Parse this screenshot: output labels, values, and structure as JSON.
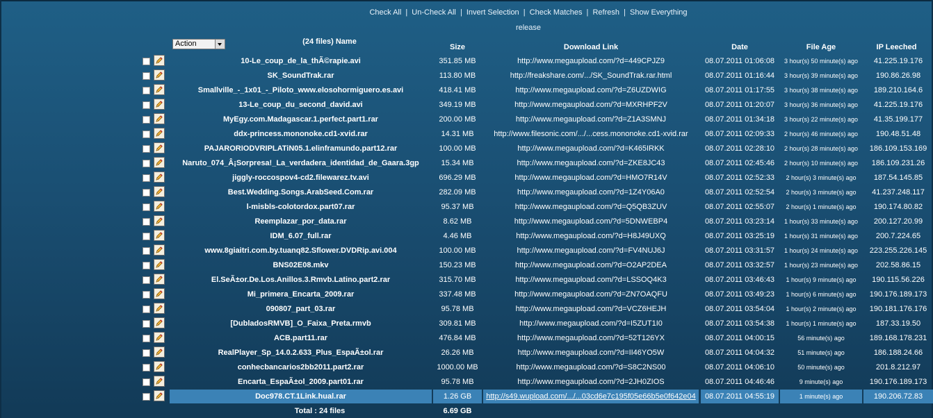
{
  "toolbar": {
    "check_all": "Check All",
    "uncheck_all": "Un-Check All",
    "invert_selection": "Invert Selection",
    "check_matches": "Check Matches",
    "refresh": "Refresh",
    "show_everything": "Show Everything",
    "separator": "|"
  },
  "release_label": "release",
  "action_select": {
    "value": "Action"
  },
  "headers": {
    "name": "(24 files) Name",
    "size": "Size",
    "link": "Download Link",
    "date": "Date",
    "age": "File Age",
    "ip": "IP Leeched"
  },
  "rows": [
    {
      "name": "10-Le_coup_de_la_thÃ©rapie.avi",
      "size": "351.85 MB",
      "link": "http://www.megaupload.com/?d=449CPJZ9",
      "date": "08.07.2011 01:06:08",
      "age": "3 hour(s) 50 minute(s) ago",
      "ip": "41.225.19.176"
    },
    {
      "name": "SK_SoundTrak.rar",
      "size": "113.80 MB",
      "link": "http://freakshare.com/.../SK_SoundTrak.rar.html",
      "date": "08.07.2011 01:16:44",
      "age": "3 hour(s) 39 minute(s) ago",
      "ip": "190.86.26.98"
    },
    {
      "name": "Smallville_-_1x01_-_Piloto_www.elosohormiguero.es.avi",
      "size": "418.41 MB",
      "link": "http://www.megaupload.com/?d=Z6UZDWIG",
      "date": "08.07.2011 01:17:55",
      "age": "3 hour(s) 38 minute(s) ago",
      "ip": "189.210.164.6"
    },
    {
      "name": "13-Le_coup_du_second_david.avi",
      "size": "349.19 MB",
      "link": "http://www.megaupload.com/?d=MXRHPF2V",
      "date": "08.07.2011 01:20:07",
      "age": "3 hour(s) 36 minute(s) ago",
      "ip": "41.225.19.176"
    },
    {
      "name": "MyEgy.com.Madagascar.1.perfect.part1.rar",
      "size": "200.00 MB",
      "link": "http://www.megaupload.com/?d=Z1A3SMNJ",
      "date": "08.07.2011 01:34:18",
      "age": "3 hour(s) 22 minute(s) ago",
      "ip": "41.35.199.177"
    },
    {
      "name": "ddx-princess.mononoke.cd1-xvid.rar",
      "size": "14.31 MB",
      "link": "http://www.filesonic.com/.../...cess.mononoke.cd1-xvid.rar",
      "date": "08.07.2011 02:09:33",
      "age": "2 hour(s) 46 minute(s) ago",
      "ip": "190.48.51.48"
    },
    {
      "name": "PAJARORIODVRIPLATiN05.1.elinframundo.part12.rar",
      "size": "100.00 MB",
      "link": "http://www.megaupload.com/?d=K465IRKK",
      "date": "08.07.2011 02:28:10",
      "age": "2 hour(s) 28 minute(s) ago",
      "ip": "186.109.153.169"
    },
    {
      "name": "Naruto_074_Â¡Sorpresa!_La_verdadera_identidad_de_Gaara.3gp",
      "size": "15.34 MB",
      "link": "http://www.megaupload.com/?d=ZKE8JC43",
      "date": "08.07.2011 02:45:46",
      "age": "2 hour(s) 10 minute(s) ago",
      "ip": "186.109.231.26"
    },
    {
      "name": "jiggly-roccospov4-cd2.filewarez.tv.avi",
      "size": "696.29 MB",
      "link": "http://www.megaupload.com/?d=HMO7R14V",
      "date": "08.07.2011 02:52:33",
      "age": "2 hour(s) 3 minute(s) ago",
      "ip": "187.54.145.85"
    },
    {
      "name": "Best.Wedding.Songs.ArabSeed.Com.rar",
      "size": "282.09 MB",
      "link": "http://www.megaupload.com/?d=1Z4Y06A0",
      "date": "08.07.2011 02:52:54",
      "age": "2 hour(s) 3 minute(s) ago",
      "ip": "41.237.248.117"
    },
    {
      "name": "l-misbls-colotordox.part07.rar",
      "size": "95.37 MB",
      "link": "http://www.megaupload.com/?d=Q5QB3ZUV",
      "date": "08.07.2011 02:55:07",
      "age": "2 hour(s) 1 minute(s) ago",
      "ip": "190.174.80.82"
    },
    {
      "name": "Reemplazar_por_data.rar",
      "size": "8.62 MB",
      "link": "http://www.megaupload.com/?d=5DNWEBP4",
      "date": "08.07.2011 03:23:14",
      "age": "1 hour(s) 33 minute(s) ago",
      "ip": "200.127.20.99"
    },
    {
      "name": "IDM_6.07_full.rar",
      "size": "4.46 MB",
      "link": "http://www.megaupload.com/?d=H8J49UXQ",
      "date": "08.07.2011 03:25:19",
      "age": "1 hour(s) 31 minute(s) ago",
      "ip": "200.7.224.65"
    },
    {
      "name": "www.8giaitri.com.by.tuanq82.Sflower.DVDRip.avi.004",
      "size": "100.00 MB",
      "link": "http://www.megaupload.com/?d=FV4NUJ6J",
      "date": "08.07.2011 03:31:57",
      "age": "1 hour(s) 24 minute(s) ago",
      "ip": "223.255.226.145"
    },
    {
      "name": "BNS02E08.mkv",
      "size": "150.23 MB",
      "link": "http://www.megaupload.com/?d=O2AP2DEA",
      "date": "08.07.2011 03:32:57",
      "age": "1 hour(s) 23 minute(s) ago",
      "ip": "202.58.86.15"
    },
    {
      "name": "El.SeÃ±or.De.Los.Anillos.3.Rmvb.Latino.part2.rar",
      "size": "315.70 MB",
      "link": "http://www.megaupload.com/?d=LSSOQ4K3",
      "date": "08.07.2011 03:46:43",
      "age": "1 hour(s) 9 minute(s) ago",
      "ip": "190.115.56.226"
    },
    {
      "name": "Mi_primera_Encarta_2009.rar",
      "size": "337.48 MB",
      "link": "http://www.megaupload.com/?d=ZN7OAQFU",
      "date": "08.07.2011 03:49:23",
      "age": "1 hour(s) 6 minute(s) ago",
      "ip": "190.176.189.173"
    },
    {
      "name": "090807_part_03.rar",
      "size": "95.78 MB",
      "link": "http://www.megaupload.com/?d=VCZ6HEJH",
      "date": "08.07.2011 03:54:04",
      "age": "1 hour(s) 2 minute(s) ago",
      "ip": "190.181.176.176"
    },
    {
      "name": "[DubladosRMVB]_O_Faixa_Preta.rmvb",
      "size": "309.81 MB",
      "link": "http://www.megaupload.com/?d=I5ZUT1I0",
      "date": "08.07.2011 03:54:38",
      "age": "1 hour(s) 1 minute(s) ago",
      "ip": "187.33.19.50"
    },
    {
      "name": "ACB.part11.rar",
      "size": "476.84 MB",
      "link": "http://www.megaupload.com/?d=52T126YX",
      "date": "08.07.2011 04:00:15",
      "age": "56 minute(s) ago",
      "ip": "189.168.178.231"
    },
    {
      "name": "RealPlayer_Sp_14.0.2.633_Plus_EspaÃ±ol.rar",
      "size": "26.26 MB",
      "link": "http://www.megaupload.com/?d=II46YO5W",
      "date": "08.07.2011 04:04:32",
      "age": "51 minute(s) ago",
      "ip": "186.188.24.66"
    },
    {
      "name": "conhecbancarios2bb2011.part2.rar",
      "size": "1000.00 MB",
      "link": "http://www.megaupload.com/?d=S8C2NS00",
      "date": "08.07.2011 04:06:10",
      "age": "50 minute(s) ago",
      "ip": "201.8.212.97"
    },
    {
      "name": "Encarta_EspaÃ±ol_2009.part01.rar",
      "size": "95.78 MB",
      "link": "http://www.megaupload.com/?d=2JH0ZIOS",
      "date": "08.07.2011 04:46:46",
      "age": "9 minute(s) ago",
      "ip": "190.176.189.173"
    },
    {
      "name": "Doc978.CT.1Link.hual.rar",
      "size": "1.26 GB",
      "link": "http://s49.wupload.com/.../...03cd6e7c195f05e66b5e0f642e04",
      "date": "08.07.2011 04:55:19",
      "age": "1 minute(s) ago",
      "ip": "190.206.72.83",
      "selected": true
    }
  ],
  "totals": {
    "files": "Total : 24 files",
    "size": "6.69 GB"
  },
  "colors": {
    "background": "#1a4f73",
    "selected_row": "#3b82b6",
    "text": "#ffffff"
  }
}
